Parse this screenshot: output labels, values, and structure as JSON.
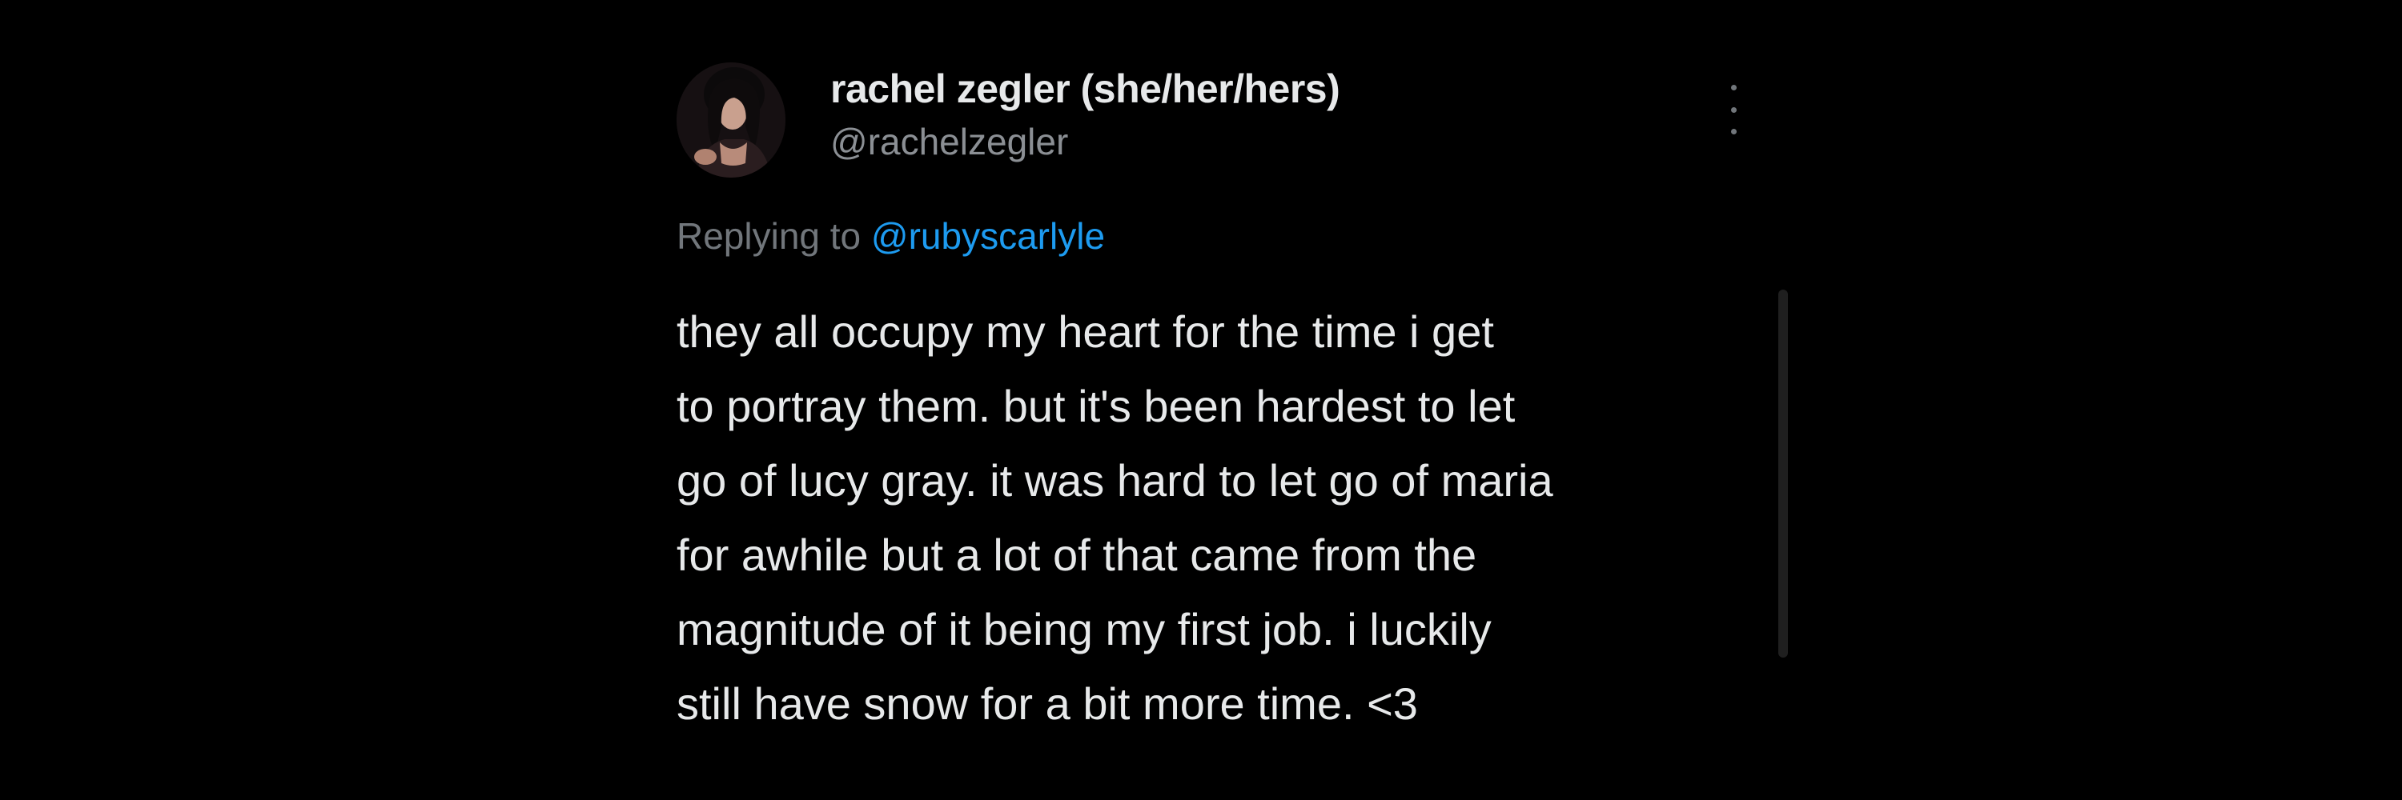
{
  "tweet": {
    "avatar_icon": "profile-photo",
    "display_name": "rachel zegler (she/her/hers)",
    "handle": "@rachelzegler",
    "more_icon": "more-vertical-icon",
    "replying_prefix": "Replying to",
    "replying_mention": "@rubyscarlyle",
    "body_lines": [
      "they all occupy my heart for the time i get",
      "to portray them. but it's been hardest to let",
      "go of lucy gray. it was hard to let go of maria",
      "for awhile but a lot of that came from the",
      "magnitude of it being my first job. i luckily",
      "still have snow for a bit more time. <3"
    ]
  },
  "colors": {
    "background": "#000000",
    "primary_text": "#e7e9ea",
    "secondary_text": "#71767b",
    "link": "#1d9bf0"
  }
}
